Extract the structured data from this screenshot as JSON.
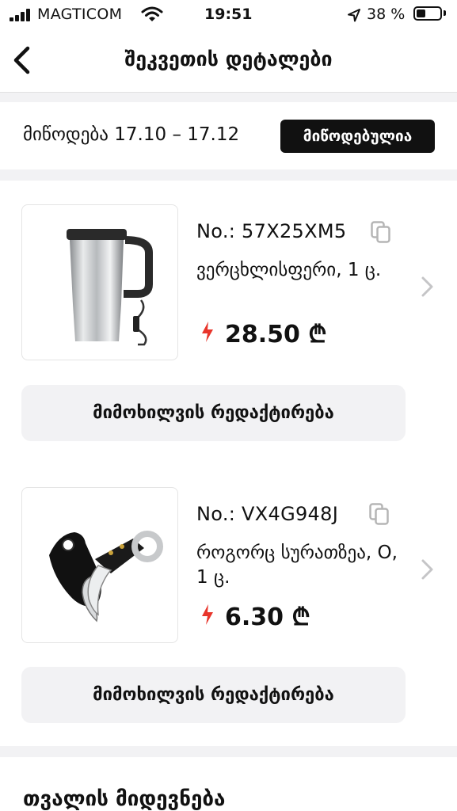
{
  "status_bar": {
    "carrier": "MAGTICOM",
    "time": "19:51",
    "battery": "38 %",
    "battery_level": 0.38
  },
  "nav": {
    "title": "შეკვეთის დეტალები"
  },
  "delivery": {
    "text": "მიწოდება 17.10 – 17.12",
    "status_badge": "მიწოდებულია"
  },
  "items": [
    {
      "order_no": "No.: 57X25XM5",
      "variant": "ვერცხლისფერი, 1 ც.",
      "price": "28.50 ₾",
      "review_button": "მიმოხილვის რედაქტირება",
      "image": "steel-travel-mug"
    },
    {
      "order_no": "No.: VX4G948J",
      "variant": "როგორც სურათზეა, O, 1 ც.",
      "price": "6.30 ₾",
      "review_button": "მიმოხილვის რედაქტირება",
      "image": "karambit-knife"
    }
  ],
  "tracking": {
    "title": "თვალის მიდევნება"
  },
  "colors": {
    "accent_red": "#e8352b",
    "badge_bg": "#111111",
    "band_gray": "#f2f2f4"
  }
}
